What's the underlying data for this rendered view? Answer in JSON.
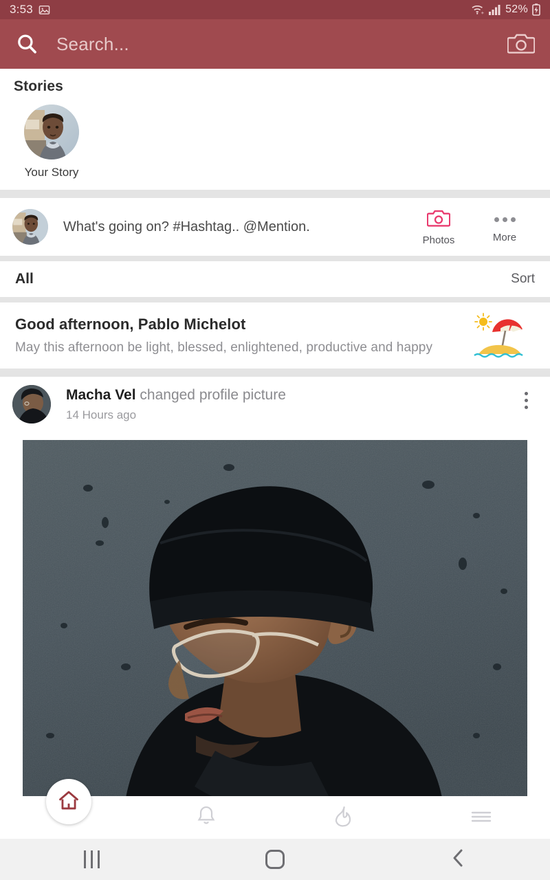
{
  "status_bar": {
    "time": "3:53",
    "image_icon": "image-icon",
    "wifi_icon": "wifi-icon",
    "signal_icon": "cellular-signal-icon",
    "battery_percent": "52%",
    "battery_icon": "battery-charging-icon"
  },
  "header": {
    "search_icon": "search-icon",
    "search_placeholder": "Search...",
    "camera_icon": "camera-icon",
    "background_color": "#a04a4f",
    "status_background_color": "#8e3d44"
  },
  "stories": {
    "title": "Stories",
    "items": [
      {
        "label": "Your Story",
        "avatar": "user-portrait-avatar"
      }
    ]
  },
  "composer": {
    "avatar": "user-portrait-avatar",
    "placeholder": "What's going on? #Hashtag.. @Mention.",
    "actions": [
      {
        "label": "Photos",
        "icon": "camera-icon",
        "color": "#e93a6e"
      },
      {
        "label": "More",
        "icon": "more-horizontal-icon",
        "color": "#8d8d92"
      }
    ]
  },
  "filter_bar": {
    "active_filter": "All",
    "sort_label": "Sort"
  },
  "greeting": {
    "title": "Good afternoon, Pablo Michelot",
    "subtitle": "May this afternoon be light, blessed, enlightened, productive and happy",
    "emoji": "beach-with-umbrella-emoji"
  },
  "post": {
    "author": "Macha Vel",
    "action": "changed profile picture",
    "timestamp": "14 Hours ago",
    "menu_icon": "more-vertical-icon",
    "image_alt": "man-in-black-beanie-and-glasses-profile-photo"
  },
  "bottom_nav": {
    "items": [
      {
        "name": "home",
        "icon": "home-icon",
        "active": true,
        "color": "#9b3a40"
      },
      {
        "name": "notifications",
        "icon": "bell-icon",
        "active": false
      },
      {
        "name": "trending",
        "icon": "flame-icon",
        "active": false
      },
      {
        "name": "menu",
        "icon": "hamburger-menu-icon",
        "active": false
      }
    ]
  },
  "system_nav": {
    "recents_icon": "recents-icon",
    "home_icon": "home-square-icon",
    "back_icon": "back-chevron-icon"
  }
}
